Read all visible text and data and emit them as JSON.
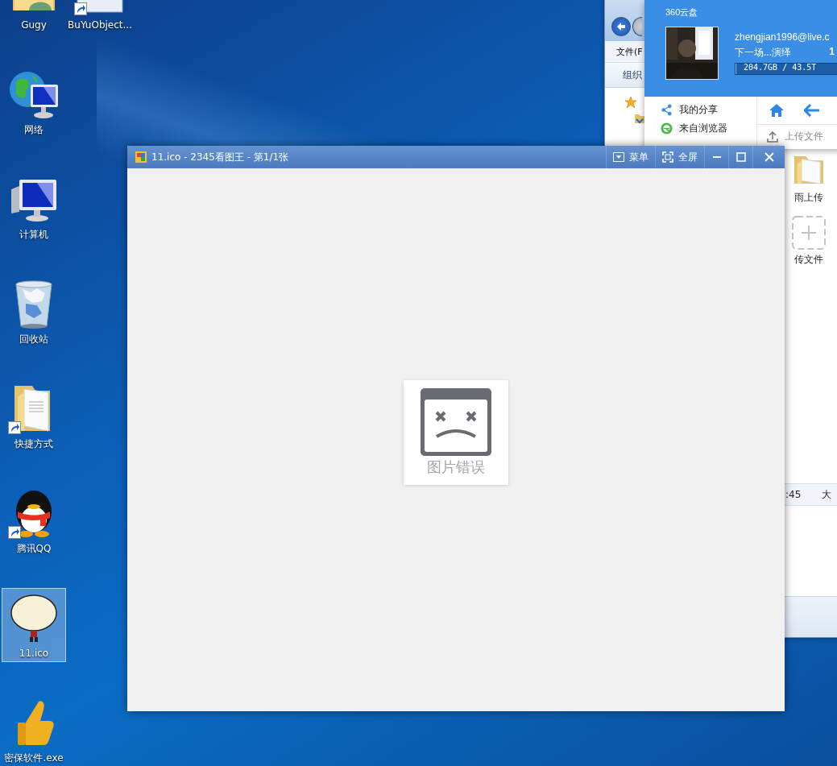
{
  "desktop_icons": [
    {
      "label": "Gugy",
      "kind": "user-folder",
      "selected": false,
      "shortcut": false
    },
    {
      "label": "网络",
      "kind": "network",
      "selected": false,
      "shortcut": false
    },
    {
      "label": "计算机",
      "kind": "computer",
      "selected": false,
      "shortcut": false
    },
    {
      "label": "回收站",
      "kind": "recycle-bin",
      "selected": false,
      "shortcut": false
    },
    {
      "label": "快捷方式",
      "kind": "folder",
      "selected": false,
      "shortcut": true
    },
    {
      "label": "腾讯QQ",
      "kind": "penguin",
      "selected": false,
      "shortcut": true
    },
    {
      "label": "11.ico",
      "kind": "cartoon",
      "selected": true,
      "shortcut": false
    },
    {
      "label": "密保软件.exe",
      "kind": "thumbs-up",
      "selected": false,
      "shortcut": false
    }
  ],
  "desktop_icons_column_2": [
    {
      "label": "BuYuObject...",
      "kind": "app",
      "selected": false,
      "shortcut": true
    }
  ],
  "explorer_window": {
    "menu_item": "文件(F",
    "toolbar_item": "组织",
    "items": [
      {
        "label": "雨上传",
        "kind": "folder"
      },
      {
        "label": "传文件",
        "kind": "upload"
      }
    ],
    "status_bar": [
      ":45",
      "大"
    ]
  },
  "cloud_panel": {
    "title": "360云盘",
    "email": "zhengjian1996@live.c",
    "nickname": "下一场...演绎",
    "count": "1",
    "storage": {
      "level": 0.01,
      "reading": "204.7GB / 43.5T"
    },
    "nav_items": [
      {
        "label": "我的分享",
        "kind": "share"
      },
      {
        "label": "来自浏览器",
        "kind": "browser"
      }
    ],
    "upload_button": "上传文件"
  },
  "viewer_window": {
    "title": "11.ico - 2345看图王 - 第1/1张",
    "buttons": [
      {
        "label": "菜单",
        "kind": "menu"
      },
      {
        "label": "全屏",
        "kind": "fullscreen"
      }
    ],
    "error_text": "图片错误"
  }
}
